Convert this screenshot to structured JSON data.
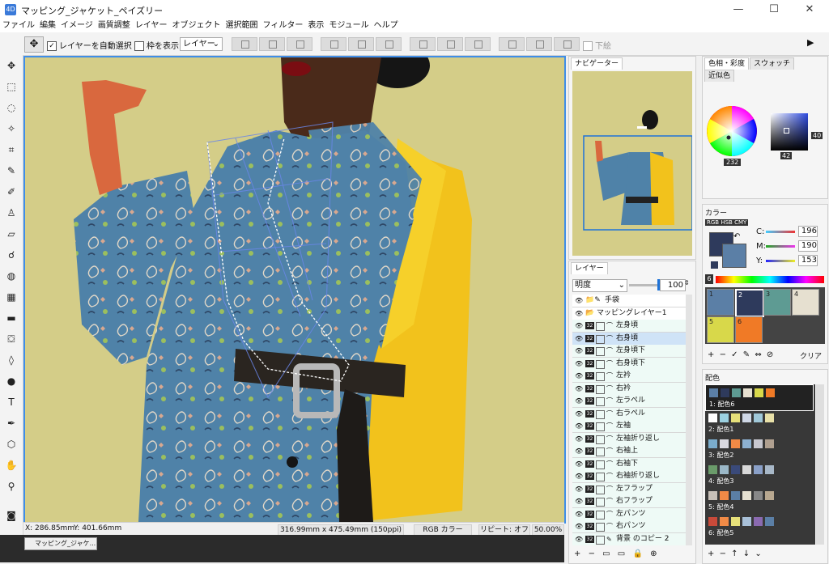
{
  "window": {
    "title": "マッピング_ジャケット_ペイズリー",
    "app_icon": "4D",
    "minimize": "—",
    "maximize": "☐",
    "close": "✕"
  },
  "menu": [
    "ファイル",
    "編集",
    "イメージ",
    "画質調整",
    "レイヤー",
    "オブジェクト",
    "選択範囲",
    "フィルター",
    "表示",
    "モジュール",
    "ヘルプ"
  ],
  "options": {
    "auto_select_label": "レイヤーを自動選択",
    "auto_select_checked": "✓",
    "show_frame_label": "枠を表示",
    "target_select": "レイヤー",
    "underline_label": "下絵",
    "play_icon": "▶"
  },
  "status": {
    "x": "X: 286.85mm",
    "y": "Y: 401.66mm",
    "size": "316.99mm x 475.49mm (150ppi)",
    "mode": "RGB カラー",
    "repeat": "リピート: オフ",
    "zoom": "50.00%"
  },
  "doc_tab": "マッピング_ジャケ...",
  "navigator": {
    "tab": "ナビゲーター"
  },
  "layers": {
    "tab": "レイヤー",
    "blend_mode": "明度",
    "opacity": "100",
    "opacity_level": 1.0,
    "rows": [
      {
        "name": "手袋",
        "type": "folder-pen"
      },
      {
        "name": "マッピングレイヤー1",
        "type": "folder"
      },
      {
        "name": "左身頃",
        "type": "layer"
      },
      {
        "name": "右身頃",
        "type": "layer",
        "selected": true
      },
      {
        "name": "左身頃下",
        "type": "layer"
      },
      {
        "name": "右身頃下",
        "type": "layer"
      },
      {
        "name": "左衿",
        "type": "layer"
      },
      {
        "name": "右衿",
        "type": "layer"
      },
      {
        "name": "左ラペル",
        "type": "layer"
      },
      {
        "name": "右ラペル",
        "type": "layer"
      },
      {
        "name": "左袖",
        "type": "layer"
      },
      {
        "name": "左袖折り返し",
        "type": "layer"
      },
      {
        "name": "右袖上",
        "type": "layer"
      },
      {
        "name": "右袖下",
        "type": "layer"
      },
      {
        "name": "右袖折り返し",
        "type": "layer"
      },
      {
        "name": "左フラップ",
        "type": "layer"
      },
      {
        "name": "右フラップ",
        "type": "layer"
      },
      {
        "name": "左パンツ",
        "type": "layer"
      },
      {
        "name": "右パンツ",
        "type": "layer"
      },
      {
        "name": "背景 のコピー 2",
        "type": "layer-pen"
      }
    ],
    "badge": "32",
    "footer_icons": [
      "+",
      "−",
      "▭",
      "▭",
      "🔒",
      "⊕"
    ]
  },
  "color_picker": {
    "tabs": [
      "色相・彩度",
      "スウォッチ",
      "近似色"
    ],
    "value_v": "40",
    "value_hue": "232",
    "value_sat": "42"
  },
  "color_panel": {
    "title": "カラー",
    "mode_tabs": [
      "RGB",
      "HSB",
      "CMY"
    ],
    "c_label": "C:",
    "c_value": "196",
    "m_label": "M:",
    "m_value": "190",
    "y_label": "Y:",
    "y_value": "153",
    "palette_no": "6",
    "palette": [
      {
        "no": "1",
        "color": "#5b7fa6"
      },
      {
        "no": "2",
        "color": "#2e3a5c"
      },
      {
        "no": "3",
        "color": "#5e9b93"
      },
      {
        "no": "4",
        "color": "#e6e0d0"
      },
      {
        "no": "5",
        "color": "#d8d84a"
      },
      {
        "no": "6",
        "color": "#f07a26"
      }
    ],
    "clear_label": "クリア"
  },
  "scheme_panel": {
    "title": "配色",
    "rows": [
      {
        "label": "1: 配色6",
        "colors": [
          "#5b7fa6",
          "#2e3a5c",
          "#5e9b93",
          "#e6e0d0",
          "#d8d84a",
          "#f07a26"
        ]
      },
      {
        "label": "2: 配色1",
        "colors": [
          "#ffffff",
          "#9bd0e0",
          "#e6e07a",
          "#cfd8e6",
          "#a0c8d8",
          "#e8e0a8"
        ]
      },
      {
        "label": "3: 配色2",
        "colors": [
          "#7aaccc",
          "#d8d8e0",
          "#f08a46",
          "#8cb0d0",
          "#c8c8d0",
          "#b0a090"
        ]
      },
      {
        "label": "4: 配色3",
        "colors": [
          "#6a9b6a",
          "#9bb8c8",
          "#3a4a7a",
          "#d8d8d8",
          "#8aa0c8",
          "#a8b8c8"
        ]
      },
      {
        "label": "5: 配色4",
        "colors": [
          "#c8c0b8",
          "#f08a46",
          "#5b7fa6",
          "#e6e0d0",
          "#888",
          "#b8a890"
        ]
      },
      {
        "label": "6: 配色5",
        "colors": [
          "#c84a3a",
          "#f08a46",
          "#e6e07a",
          "#a8c0d8",
          "#8a6ab0",
          "#5b7fa6"
        ]
      }
    ]
  }
}
